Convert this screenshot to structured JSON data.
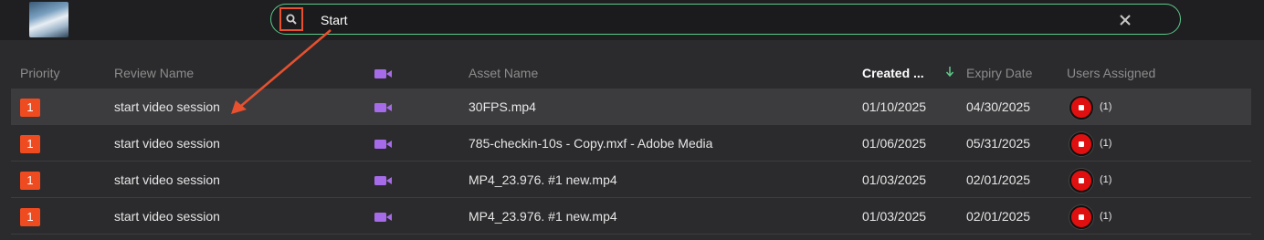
{
  "search": {
    "value": "Start",
    "placeholder": ""
  },
  "columns": {
    "priority": "Priority",
    "review_name": "Review Name",
    "media_type_icon": "video-camera-icon",
    "asset_name": "Asset Name",
    "created": "Created ...",
    "expiry": "Expiry Date",
    "users": "Users Assigned"
  },
  "sort": {
    "column": "created",
    "direction": "descending"
  },
  "colors": {
    "accent_green": "#5cc98a",
    "priority_orange": "#ef4b21",
    "video_purple": "#a66be8",
    "user_red": "#e01010"
  },
  "rows": [
    {
      "priority": "1",
      "review_name": "start video session",
      "asset_name": "30FPS.mp4",
      "created": "01/10/2025",
      "expiry": "04/30/2025",
      "users": "(1)"
    },
    {
      "priority": "1",
      "review_name": "start video session",
      "asset_name": "785-checkin-10s - Copy.mxf - Adobe Media",
      "created": "01/06/2025",
      "expiry": "05/31/2025",
      "users": "(1)"
    },
    {
      "priority": "1",
      "review_name": "start video session",
      "asset_name": "MP4_23.976. #1 new.mp4",
      "created": "01/03/2025",
      "expiry": "02/01/2025",
      "users": "(1)"
    },
    {
      "priority": "1",
      "review_name": "start video session",
      "asset_name": "MP4_23.976. #1 new.mp4",
      "created": "01/03/2025",
      "expiry": "02/01/2025",
      "users": "(1)"
    }
  ]
}
